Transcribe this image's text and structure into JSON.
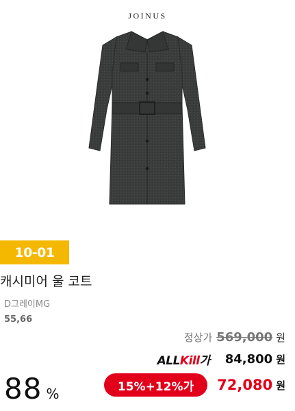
{
  "brand": {
    "logo_text": "JOINUS"
  },
  "product": {
    "image_alt": "charcoal belted wool coat",
    "badge": "10-01",
    "name": "캐시미어 울 코트",
    "color": "D그레이MG",
    "sizes": "55,66"
  },
  "pricing": {
    "regular_label": "정상가",
    "regular_price": "569,000",
    "currency": "원",
    "allkill_logo_black": "ALL",
    "allkill_logo_red": "Kill",
    "allkill_logo_suffix": "가",
    "allkill_price": "84,800",
    "discount_label": "15%+12%가",
    "sale_price": "72,080"
  },
  "rate": {
    "value": "88",
    "unit": "%"
  },
  "colors": {
    "badge": "#f5b800",
    "accent_red": "#e2001a",
    "coat": "#3a3c3b"
  }
}
